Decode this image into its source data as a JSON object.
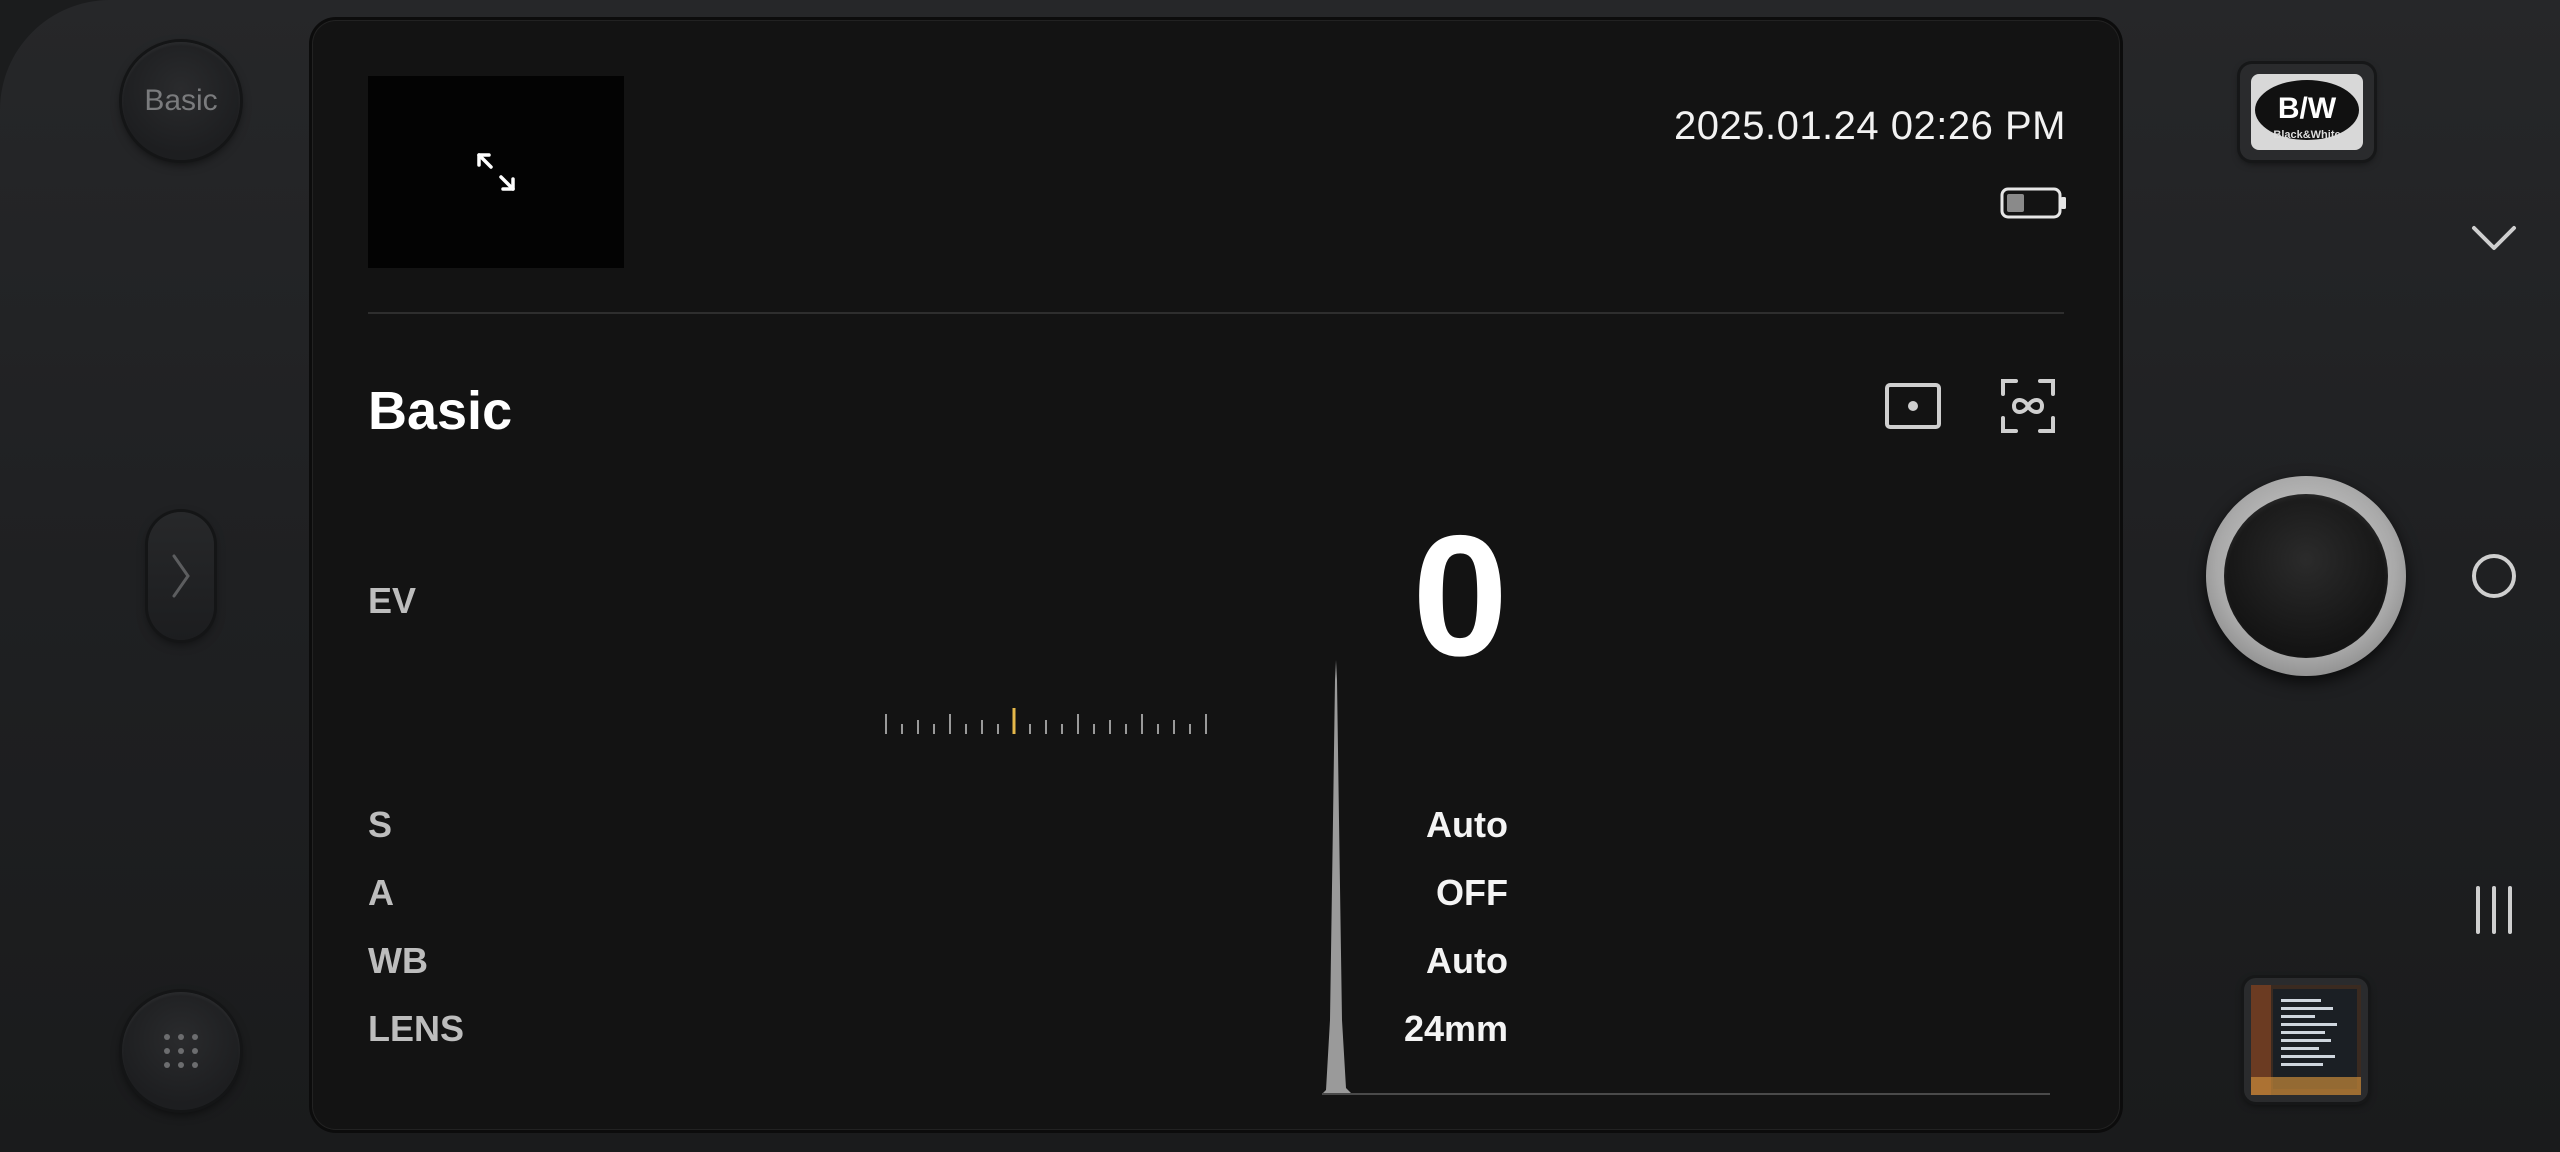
{
  "mode_button": {
    "label": "Basic"
  },
  "header": {
    "datetime": "2025.01.24 02:26 PM",
    "battery_level": 0.35
  },
  "section": {
    "title": "Basic"
  },
  "ev": {
    "label": "EV",
    "value": "0",
    "scale_position": "center"
  },
  "settings": [
    {
      "label": "S",
      "value": "Auto"
    },
    {
      "label": "A",
      "value": "OFF"
    },
    {
      "label": "WB",
      "value": "Auto"
    },
    {
      "label": "LENS",
      "value": "24mm"
    }
  ],
  "filter_button": {
    "line1": "B/W",
    "line2": "Black&White"
  },
  "icons": {
    "expand": "expand-icon",
    "focus_point": "focus-point-icon",
    "infinity_focus": "infinity-focus-icon",
    "chevron": "chevron-down-icon",
    "home": "circle-home-icon",
    "recents": "recents-icon",
    "grid": "dots-grid-icon",
    "side_handle": "chevron-right-icon"
  },
  "colors": {
    "accent": "#e6b84a",
    "panel": "#131313",
    "text": "#ffffff"
  }
}
